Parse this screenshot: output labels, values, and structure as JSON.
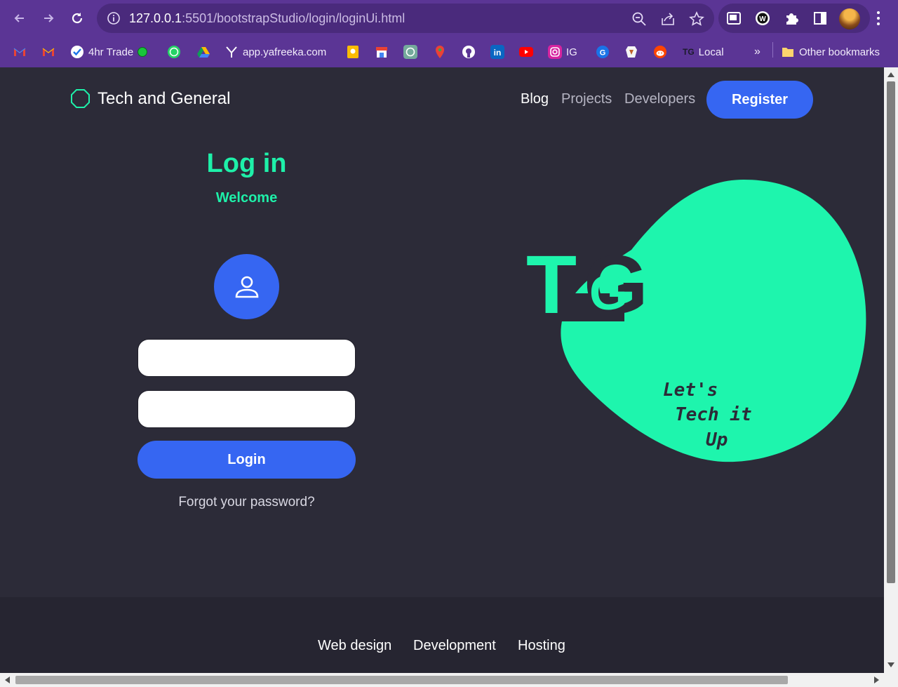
{
  "browser": {
    "url_host": "127.0.0.1",
    "url_rest": ":5501/bootstrapStudio/login/loginUi.html",
    "bookmarks": [
      {
        "label": "",
        "icon": "gmail-icon"
      },
      {
        "label": "",
        "icon": "gmail-icon"
      },
      {
        "label": "4hr Trade",
        "icon": "check-icon"
      },
      {
        "label": "",
        "icon": "whatsapp-icon"
      },
      {
        "label": "",
        "icon": "drive-icon"
      },
      {
        "label": "app.yafreeka.com",
        "icon": "y-icon"
      },
      {
        "label": "",
        "icon": "keep-icon"
      },
      {
        "label": "",
        "icon": "store-icon"
      },
      {
        "label": "",
        "icon": "chatgpt-icon"
      },
      {
        "label": "",
        "icon": "maps-icon"
      },
      {
        "label": "",
        "icon": "github-icon"
      },
      {
        "label": "",
        "icon": "linkedin-icon"
      },
      {
        "label": "",
        "icon": "youtube-icon"
      },
      {
        "label": "IG",
        "icon": "instagram-icon"
      },
      {
        "label": "",
        "icon": "grammarly-icon"
      },
      {
        "label": "",
        "icon": "brave-icon"
      },
      {
        "label": "",
        "icon": "reddit-icon"
      },
      {
        "label": "Local",
        "icon": "tg-icon"
      }
    ],
    "tg_text": "TG",
    "more_bookmarks": "»",
    "other_bookmarks": "Other bookmarks"
  },
  "navbar": {
    "brand": "Tech and General",
    "links": [
      "Blog",
      "Projects",
      "Developers"
    ],
    "register": "Register"
  },
  "login": {
    "title": "Log in",
    "subtitle": "Welcome",
    "username_value": "",
    "password_value": "",
    "button": "Login",
    "forgot": "Forgot your password?"
  },
  "art": {
    "logo_t": "T",
    "logo_g": "G",
    "tagline_1": "Let's",
    "tagline_2": "Tech it",
    "tagline_3": "Up"
  },
  "footer": {
    "links": [
      "Web design",
      "Development",
      "Hosting"
    ]
  },
  "colors": {
    "accent_green": "#1ef0a9",
    "accent_blue": "#3666f2",
    "page_bg": "#2c2b38",
    "browser_purple": "#5b3595"
  }
}
